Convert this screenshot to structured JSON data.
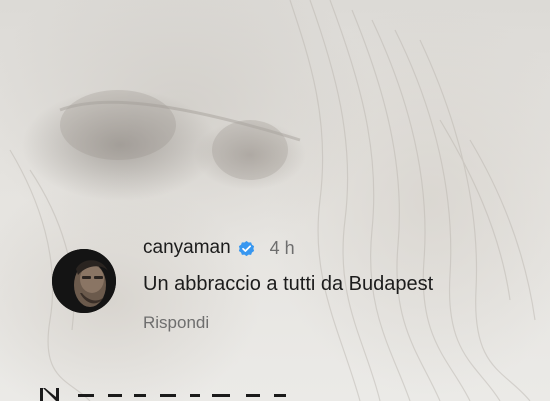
{
  "comment": {
    "username": "canyaman",
    "verified_icon": "verified-badge-icon",
    "timestamp": "4 h",
    "text": "Un abbraccio a tutti da Budapest",
    "reply_label": "Rispondi"
  },
  "colors": {
    "verified": "#3897f0",
    "username": "#1c1c1c",
    "meta": "#6e6e6e",
    "background": "#e9e8e4"
  }
}
